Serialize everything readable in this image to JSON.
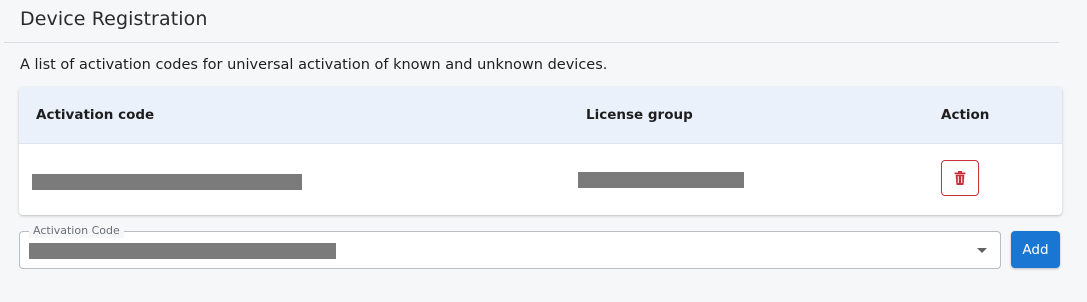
{
  "header": {
    "title": "Device Registration",
    "description": "A list of activation codes for universal activation of known and unknown devices."
  },
  "table": {
    "columns": [
      "Activation code",
      "License group",
      "Action"
    ],
    "rows": [
      {
        "activation_code": "[redacted]",
        "license_group": "[redacted]",
        "action_icon": "trash-icon"
      }
    ]
  },
  "form": {
    "activation_code_label": "Activation Code",
    "activation_code_value": "[redacted]",
    "add_label": "Add"
  },
  "colors": {
    "header_bg": "#eaf1fb",
    "delete_accent": "#c9303a",
    "primary_button": "#1976d2",
    "redaction": "#7b7b7b"
  }
}
